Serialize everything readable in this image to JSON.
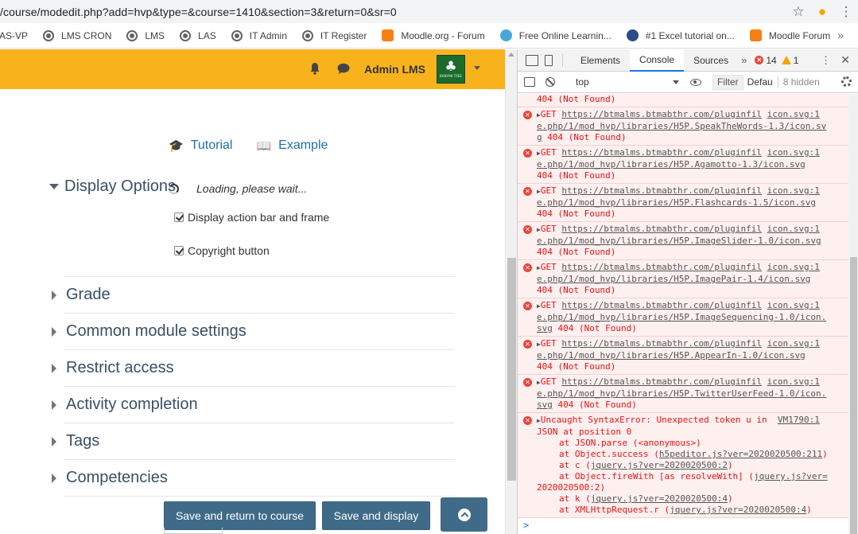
{
  "browser": {
    "url_visible": "/course/modedit.php?add=hvp&type=&course=1410&section=3&return=0&sr=0",
    "bookmarks": [
      {
        "label": "AS-VP",
        "icon": "globe-icon"
      },
      {
        "label": "LMS CRON",
        "icon": "globe-icon"
      },
      {
        "label": "LMS",
        "icon": "globe-icon"
      },
      {
        "label": "LAS",
        "icon": "globe-icon"
      },
      {
        "label": "IT Admin",
        "icon": "globe-icon"
      },
      {
        "label": "IT Register",
        "icon": "globe-icon"
      },
      {
        "label": "Moodle.org - Forum",
        "icon": "moodle-icon"
      },
      {
        "label": "Free Online Learnin...",
        "icon": "learning-icon"
      },
      {
        "label": "#1 Excel tutorial on...",
        "icon": "excel-tutorial-icon"
      },
      {
        "label": "Moodle Forum",
        "icon": "moodle-icon"
      }
    ],
    "more_label": "»"
  },
  "navbar": {
    "username": "Admin LMS",
    "logo_text": "BANYAN TREE",
    "accent": "#f8b31c"
  },
  "form": {
    "tutorial_label": "Tutorial",
    "example_label": "Example",
    "loading_text": "Loading, please wait...",
    "display_options_title": "Display Options",
    "checkbox_action_bar": "Display action bar and frame",
    "checkbox_copyright": "Copyright button",
    "sections": [
      "Grade",
      "Common module settings",
      "Restrict access",
      "Activity completion",
      "Tags",
      "Competencies"
    ],
    "save_return_label": "Save and return to course",
    "save_display_label": "Save and display"
  },
  "devtools": {
    "tabs": [
      "Elements",
      "Console",
      "Sources"
    ],
    "active_tab": "Console",
    "more_tabs": "»",
    "error_count": "14",
    "warning_count": "1",
    "context": "top",
    "filter_placeholder": "Filter",
    "levels": "Defau",
    "hidden": "8 hidden",
    "top_partial": "404 (Not Found)",
    "entries": [
      {
        "method": "GET",
        "url": "https://btmalms.btmabthr.com/pluginfile.php/1/mod_hvp/libraries/H5P.SpeakTheWords-1.3/icon.svg",
        "url_l1": "https://btmalms.btmabthr.com/pluginfil",
        "src": "icon.svg:1",
        "url_l2": "e.php/1/mod_hvp/libraries/H5P.SpeakTheWords-1.3/icon.sv",
        "url_l3": "g",
        "status": "404 (Not Found)"
      },
      {
        "method": "GET",
        "url": "https://btmalms.btmabthr.com/pluginfile.php/1/mod_hvp/libraries/H5P.Agamotto-1.3/icon.svg",
        "url_l1": "https://btmalms.btmabthr.com/pluginfil",
        "src": "icon.svg:1",
        "url_l2": "e.php/1/mod_hvp/libraries/H5P.Agamotto-1.3/icon.svg",
        "status": "404 (Not Found)"
      },
      {
        "method": "GET",
        "url": "https://btmalms.btmabthr.com/pluginfile.php/1/mod_hvp/libraries/H5P.Flashcards-1.5/icon.svg",
        "url_l1": "https://btmalms.btmabthr.com/pluginfil",
        "src": "icon.svg:1",
        "url_l2": "e.php/1/mod_hvp/libraries/H5P.Flashcards-1.5/icon.svg",
        "status": "404 (Not Found)"
      },
      {
        "method": "GET",
        "url": "https://btmalms.btmabthr.com/pluginfile.php/1/mod_hvp/libraries/H5P.ImageSlider-1.0/icon.svg",
        "url_l1": "https://btmalms.btmabthr.com/pluginfil",
        "src": "icon.svg:1",
        "url_l2": "e.php/1/mod_hvp/libraries/H5P.ImageSlider-1.0/icon.svg",
        "status": "404 (Not Found)"
      },
      {
        "method": "GET",
        "url": "https://btmalms.btmabthr.com/pluginfile.php/1/mod_hvp/libraries/H5P.ImagePair-1.4/icon.svg",
        "url_l1": "https://btmalms.btmabthr.com/pluginfil",
        "src": "icon.svg:1",
        "url_l2": "e.php/1/mod_hvp/libraries/H5P.ImagePair-1.4/icon.svg",
        "status": "404 (Not Found)"
      },
      {
        "method": "GET",
        "url": "https://btmalms.btmabthr.com/pluginfile.php/1/mod_hvp/libraries/H5P.ImageSequencing-1.0/icon.svg",
        "url_l1": "https://btmalms.btmabthr.com/pluginfil",
        "src": "icon.svg:1",
        "url_l2": "e.php/1/mod_hvp/libraries/H5P.ImageSequencing-1.0/icon.",
        "url_l3": "svg",
        "status": "404 (Not Found)"
      },
      {
        "method": "GET",
        "url": "https://btmalms.btmabthr.com/pluginfile.php/1/mod_hvp/libraries/H5P.AppearIn-1.0/icon.svg",
        "url_l1": "https://btmalms.btmabthr.com/pluginfil",
        "src": "icon.svg:1",
        "url_l2": "e.php/1/mod_hvp/libraries/H5P.AppearIn-1.0/icon.svg",
        "status": "404 (Not Found)"
      },
      {
        "method": "GET",
        "url": "https://btmalms.btmabthr.com/pluginfile.php/1/mod_hvp/libraries/H5P.TwitterUserFeed-1.0/icon.svg",
        "url_l1": "https://btmalms.btmabthr.com/pluginfil",
        "src": "icon.svg:1",
        "url_l2": "e.php/1/mod_hvp/libraries/H5P.TwitterUserFeed-1.0/icon.",
        "url_l3": "svg",
        "status": "404 (Not Found)"
      }
    ],
    "syntax_error": {
      "line1": "Uncaught SyntaxError: Unexpected token u in",
      "src": "VM1790:1",
      "line2": "JSON at position 0",
      "stack": [
        {
          "text": "at JSON.parse (<anonymous>)",
          "link": ""
        },
        {
          "text": "at Object.success (",
          "link": "h5peditor.js?ver=2020020500:211",
          "tail": ")"
        },
        {
          "text": "at c (",
          "link": "jquery.js?ver=2020020500:2",
          "tail": ")"
        },
        {
          "text": "at Object.fireWith [as resolveWith] (",
          "link": "jquery.js?ver=",
          "tail": ""
        },
        {
          "text": "2020020500:2",
          "link": "",
          "tail": ")",
          "cont": true
        },
        {
          "text": "at k (",
          "link": "jquery.js?ver=2020020500:4",
          "tail": ")"
        },
        {
          "text": "at XMLHttpRequest.r (",
          "link": "jquery.js?ver=2020020500:4",
          "tail": ")"
        }
      ]
    },
    "prompt": ">"
  }
}
